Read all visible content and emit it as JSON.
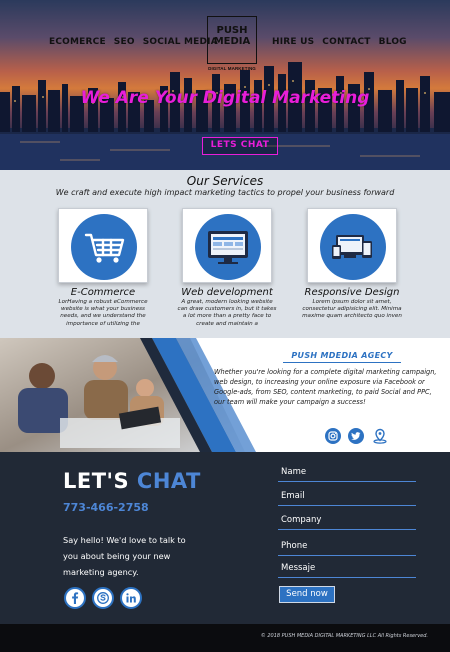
{
  "nav": {
    "left": [
      "ECOMERCE",
      "SEO",
      "SOCIAL MEDIA"
    ],
    "right": [
      "HIRE US",
      "CONTACT",
      "BLOG"
    ]
  },
  "logo": {
    "line1": "PUSH",
    "line2": "MEDIA",
    "tagline": "DIGITAL MARKETING"
  },
  "hero": {
    "title": "We Are Your Digital Marketing",
    "cta": "LETS CHAT"
  },
  "services": {
    "title": "Our Services",
    "subtitle": "We craft and execute high impact marketing tactics to propel your business forward",
    "items": [
      {
        "icon": "shopping-cart-icon",
        "title": "E-Commerce",
        "text": "LorHaving a robust eCommerce website is what your business needs, and we understand the importance of utilizing the"
      },
      {
        "icon": "monitor-icon",
        "title": "Web development",
        "text": "A great, modern looking website can draw customers in, but it takes a lot more than a pretty face to create and maintain a"
      },
      {
        "icon": "responsive-devices-icon",
        "title": "Responsive Design",
        "text": "Lorem ipsum dolor sit amet, consectetur adipisicing elit. Minima maxime quam architecto quo inven"
      }
    ]
  },
  "agency": {
    "title": "PUSH MDEDIA AGECY",
    "text": "Whether you're looking for a complete digital marketing campaign, web design, to increasing your online exposure via Facebook or Google-ads, from SEO, content marketing, to paid Social and PPC, our team will make your campaign a success!",
    "icons": [
      "instagram-icon",
      "twitter-icon",
      "location-pin-icon"
    ]
  },
  "contact": {
    "heading_white": "LET'S",
    "heading_blue": "CHAT",
    "phone": "773-466-2758",
    "text": "Say hello! We'd love to talk to you about being your new marketing agency.",
    "social": [
      "facebook-icon",
      "skype-icon",
      "linkedin-icon"
    ],
    "fields": [
      "Name",
      "Email",
      "Company",
      "Phone",
      "Messaje"
    ],
    "send": "Send now"
  },
  "footer": {
    "copyright": "© 2018 PUSH MEDIA DIGITAL MARKETING LLC All Rights Reserved."
  },
  "colors": {
    "accent": "#2d72c2",
    "hero_title": "#e81ed9",
    "dark_bg": "#212936"
  }
}
